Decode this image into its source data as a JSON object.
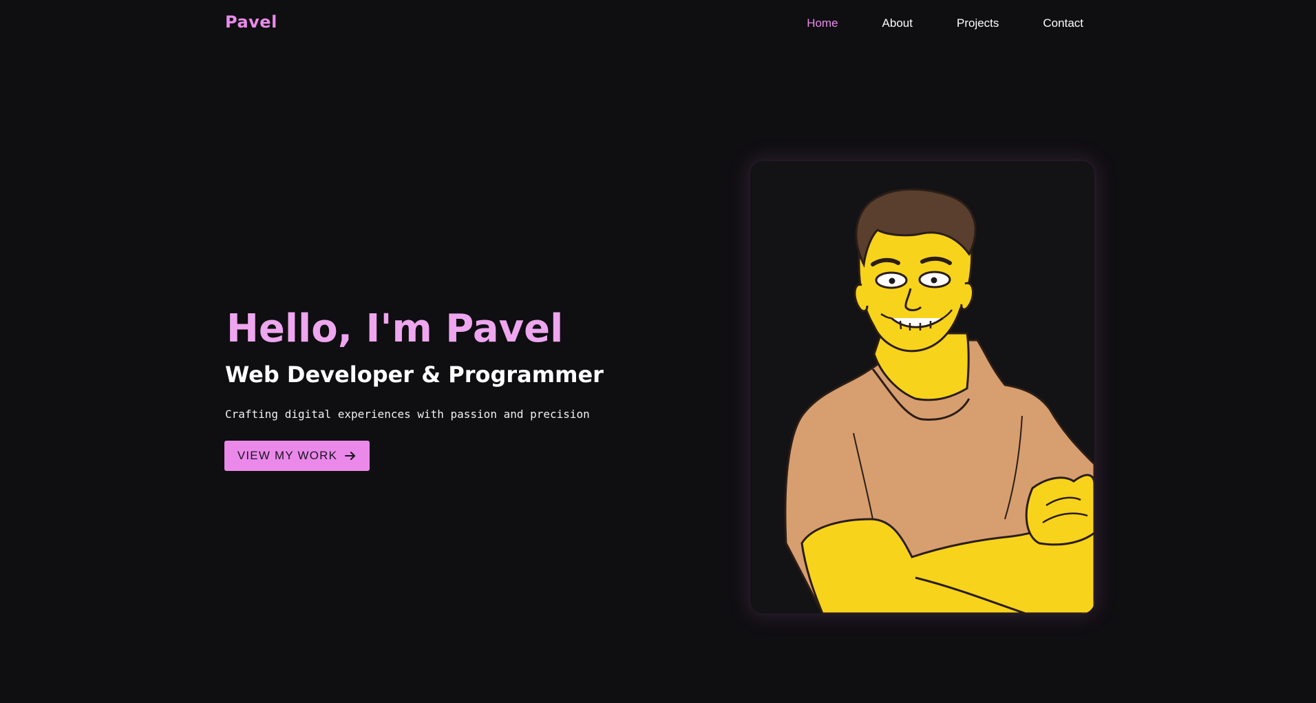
{
  "header": {
    "logo": "Pavel",
    "nav": [
      {
        "label": "Home",
        "active": true
      },
      {
        "label": "About",
        "active": false
      },
      {
        "label": "Projects",
        "active": false
      },
      {
        "label": "Contact",
        "active": false
      }
    ]
  },
  "hero": {
    "title": "Hello, I'm Pavel",
    "subtitle": "Web Developer & Programmer",
    "tagline": "Crafting digital experiences with passion and precision",
    "cta_label": "VIEW MY WORK",
    "cta_icon": "arrow-right-icon"
  },
  "portrait": {
    "description_icon": "cartoon-portrait"
  },
  "colors": {
    "background": "#0f0e11",
    "accent": "#ea89e9",
    "text": "#ffffff",
    "skin": "#f7d31c",
    "shirt": "#d79e6f",
    "hair": "#5a3f2e"
  }
}
